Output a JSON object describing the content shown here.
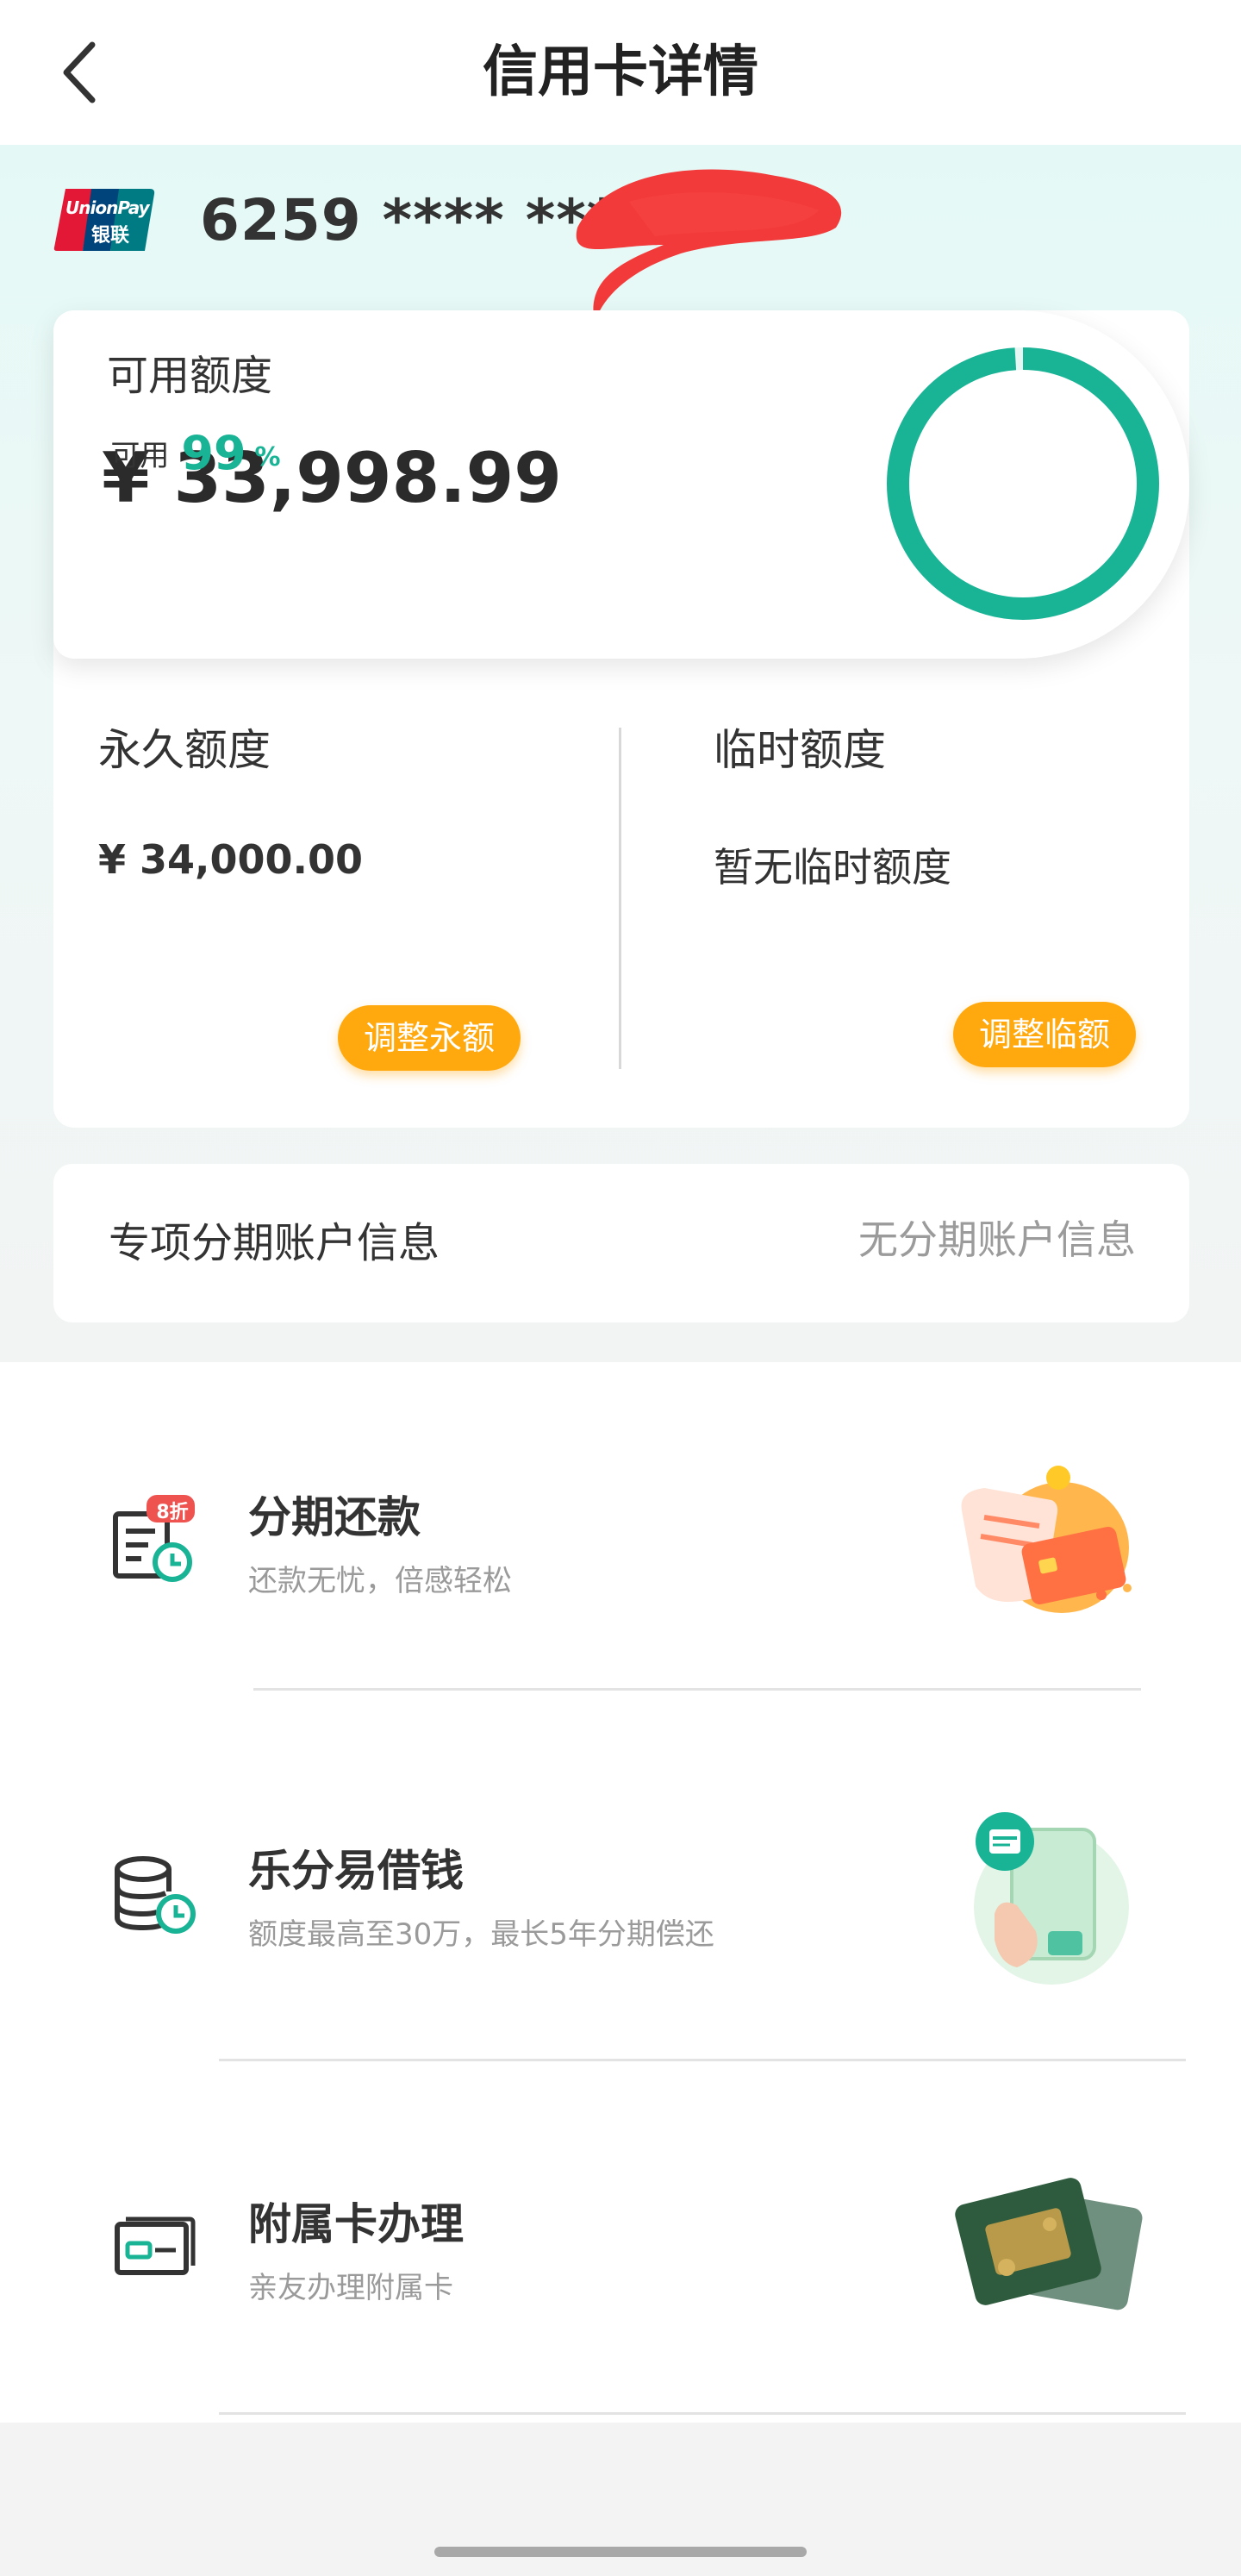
{
  "header": {
    "title": "信用卡详情",
    "back_icon": "chevron-left-icon"
  },
  "card": {
    "brand_logo": "UnionPay 银联",
    "logo_text_top": "UnionPay",
    "logo_text_bottom": "银联",
    "number_masked": "6259 **** ****"
  },
  "available": {
    "label": "可用额度",
    "amount": "¥ 33,998.99",
    "ring_label": "可用",
    "ring_percent": "99",
    "ring_unit": "%",
    "ring_fraction": 0.99,
    "ring_color": "#19b395"
  },
  "limits": {
    "permanent": {
      "title": "永久额度",
      "value": "¥ 34,000.00",
      "button": "调整永额"
    },
    "temporary": {
      "title": "临时额度",
      "value": "暂无临时额度",
      "button": "调整临额"
    },
    "button_color": "#ffa90f"
  },
  "installment_account": {
    "label": "专项分期账户信息",
    "value": "无分期账户信息"
  },
  "services": [
    {
      "title": "分期还款",
      "subtitle": "还款无忧，倍感轻松",
      "icon": "bill-clock-icon",
      "badge": "8折",
      "illustration": "receipt-card-illustration"
    },
    {
      "title": "乐分易借钱",
      "subtitle": "额度最高至30万，最长5年分期偿还",
      "icon": "coins-clock-icon",
      "illustration": "phone-hand-illustration"
    },
    {
      "title": "附属卡办理",
      "subtitle": "亲友办理附属卡",
      "icon": "card-icon",
      "illustration": "supplementary-card-illustration"
    }
  ]
}
